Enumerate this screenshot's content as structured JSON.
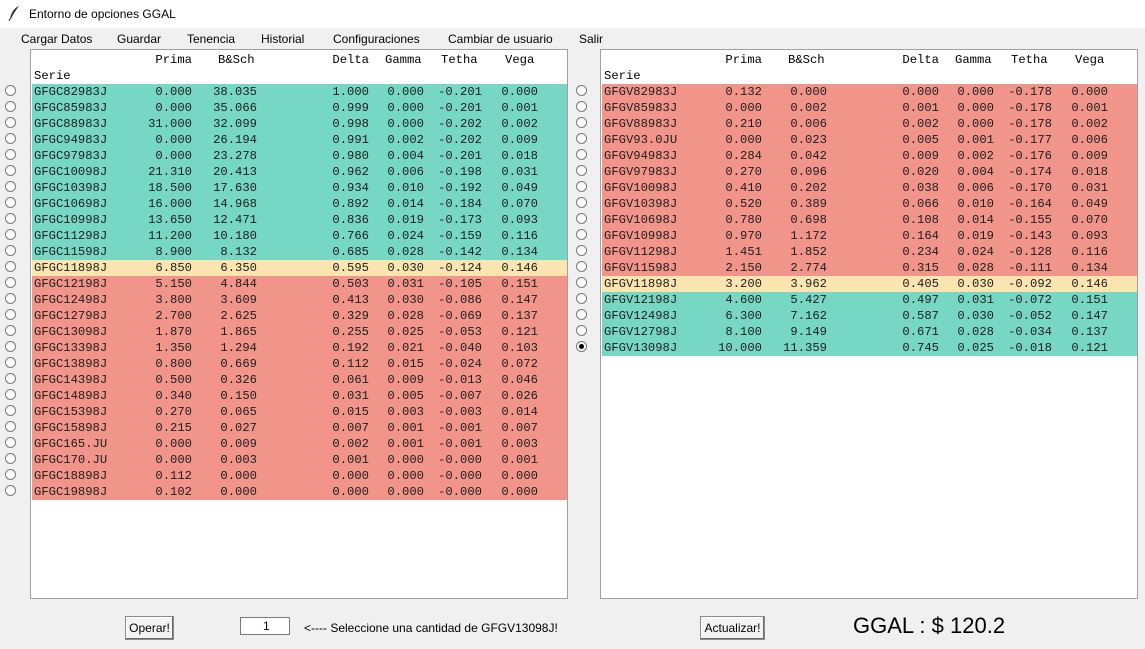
{
  "window": {
    "title": "Entorno de opciones GGAL",
    "icon": "feather-icon"
  },
  "menu": [
    "Cargar Datos",
    "Guardar",
    "Tenencia",
    "Historial",
    "Configuraciones",
    "Cambiar de usuario",
    "Salir"
  ],
  "columns": [
    "Serie",
    "Prima",
    "B&Sch",
    "Delta",
    "Gamma",
    "Tetha",
    "Vega"
  ],
  "colors": {
    "green": "#76d7c4",
    "red": "#f1948a",
    "yellow": "#fae5b0"
  },
  "calls": [
    {
      "serie": "GFGC82983J",
      "prima": "0.000",
      "bsch": "38.035",
      "delta": "1.000",
      "gamma": "0.000",
      "tetha": "-0.201",
      "vega": "0.000",
      "color": "green"
    },
    {
      "serie": "GFGC85983J",
      "prima": "0.000",
      "bsch": "35.066",
      "delta": "0.999",
      "gamma": "0.000",
      "tetha": "-0.201",
      "vega": "0.001",
      "color": "green"
    },
    {
      "serie": "GFGC88983J",
      "prima": "31.000",
      "bsch": "32.099",
      "delta": "0.998",
      "gamma": "0.000",
      "tetha": "-0.202",
      "vega": "0.002",
      "color": "green"
    },
    {
      "serie": "GFGC94983J",
      "prima": "0.000",
      "bsch": "26.194",
      "delta": "0.991",
      "gamma": "0.002",
      "tetha": "-0.202",
      "vega": "0.009",
      "color": "green"
    },
    {
      "serie": "GFGC97983J",
      "prima": "0.000",
      "bsch": "23.278",
      "delta": "0.980",
      "gamma": "0.004",
      "tetha": "-0.201",
      "vega": "0.018",
      "color": "green"
    },
    {
      "serie": "GFGC10098J",
      "prima": "21.310",
      "bsch": "20.413",
      "delta": "0.962",
      "gamma": "0.006",
      "tetha": "-0.198",
      "vega": "0.031",
      "color": "green"
    },
    {
      "serie": "GFGC10398J",
      "prima": "18.500",
      "bsch": "17.630",
      "delta": "0.934",
      "gamma": "0.010",
      "tetha": "-0.192",
      "vega": "0.049",
      "color": "green"
    },
    {
      "serie": "GFGC10698J",
      "prima": "16.000",
      "bsch": "14.968",
      "delta": "0.892",
      "gamma": "0.014",
      "tetha": "-0.184",
      "vega": "0.070",
      "color": "green"
    },
    {
      "serie": "GFGC10998J",
      "prima": "13.650",
      "bsch": "12.471",
      "delta": "0.836",
      "gamma": "0.019",
      "tetha": "-0.173",
      "vega": "0.093",
      "color": "green"
    },
    {
      "serie": "GFGC11298J",
      "prima": "11.200",
      "bsch": "10.180",
      "delta": "0.766",
      "gamma": "0.024",
      "tetha": "-0.159",
      "vega": "0.116",
      "color": "green"
    },
    {
      "serie": "GFGC11598J",
      "prima": "8.900",
      "bsch": "8.132",
      "delta": "0.685",
      "gamma": "0.028",
      "tetha": "-0.142",
      "vega": "0.134",
      "color": "green"
    },
    {
      "serie": "GFGC11898J",
      "prima": "6.850",
      "bsch": "6.350",
      "delta": "0.595",
      "gamma": "0.030",
      "tetha": "-0.124",
      "vega": "0.146",
      "color": "yellow"
    },
    {
      "serie": "GFGC12198J",
      "prima": "5.150",
      "bsch": "4.844",
      "delta": "0.503",
      "gamma": "0.031",
      "tetha": "-0.105",
      "vega": "0.151",
      "color": "red"
    },
    {
      "serie": "GFGC12498J",
      "prima": "3.800",
      "bsch": "3.609",
      "delta": "0.413",
      "gamma": "0.030",
      "tetha": "-0.086",
      "vega": "0.147",
      "color": "red"
    },
    {
      "serie": "GFGC12798J",
      "prima": "2.700",
      "bsch": "2.625",
      "delta": "0.329",
      "gamma": "0.028",
      "tetha": "-0.069",
      "vega": "0.137",
      "color": "red"
    },
    {
      "serie": "GFGC13098J",
      "prima": "1.870",
      "bsch": "1.865",
      "delta": "0.255",
      "gamma": "0.025",
      "tetha": "-0.053",
      "vega": "0.121",
      "color": "red"
    },
    {
      "serie": "GFGC13398J",
      "prima": "1.350",
      "bsch": "1.294",
      "delta": "0.192",
      "gamma": "0.021",
      "tetha": "-0.040",
      "vega": "0.103",
      "color": "red"
    },
    {
      "serie": "GFGC13898J",
      "prima": "0.800",
      "bsch": "0.669",
      "delta": "0.112",
      "gamma": "0.015",
      "tetha": "-0.024",
      "vega": "0.072",
      "color": "red"
    },
    {
      "serie": "GFGC14398J",
      "prima": "0.500",
      "bsch": "0.326",
      "delta": "0.061",
      "gamma": "0.009",
      "tetha": "-0.013",
      "vega": "0.046",
      "color": "red"
    },
    {
      "serie": "GFGC14898J",
      "prima": "0.340",
      "bsch": "0.150",
      "delta": "0.031",
      "gamma": "0.005",
      "tetha": "-0.007",
      "vega": "0.026",
      "color": "red"
    },
    {
      "serie": "GFGC15398J",
      "prima": "0.270",
      "bsch": "0.065",
      "delta": "0.015",
      "gamma": "0.003",
      "tetha": "-0.003",
      "vega": "0.014",
      "color": "red"
    },
    {
      "serie": "GFGC15898J",
      "prima": "0.215",
      "bsch": "0.027",
      "delta": "0.007",
      "gamma": "0.001",
      "tetha": "-0.001",
      "vega": "0.007",
      "color": "red"
    },
    {
      "serie": "GFGC165.JU",
      "prima": "0.000",
      "bsch": "0.009",
      "delta": "0.002",
      "gamma": "0.001",
      "tetha": "-0.001",
      "vega": "0.003",
      "color": "red"
    },
    {
      "serie": "GFGC170.JU",
      "prima": "0.000",
      "bsch": "0.003",
      "delta": "0.001",
      "gamma": "0.000",
      "tetha": "-0.000",
      "vega": "0.001",
      "color": "red"
    },
    {
      "serie": "GFGC18898J",
      "prima": "0.112",
      "bsch": "0.000",
      "delta": "0.000",
      "gamma": "0.000",
      "tetha": "-0.000",
      "vega": "0.000",
      "color": "red"
    },
    {
      "serie": "GFGC19898J",
      "prima": "0.102",
      "bsch": "0.000",
      "delta": "0.000",
      "gamma": "0.000",
      "tetha": "-0.000",
      "vega": "0.000",
      "color": "red"
    }
  ],
  "puts": [
    {
      "serie": "GFGV82983J",
      "prima": "0.132",
      "bsch": "0.000",
      "delta": "0.000",
      "gamma": "0.000",
      "tetha": "-0.178",
      "vega": "0.000",
      "color": "red"
    },
    {
      "serie": "GFGV85983J",
      "prima": "0.000",
      "bsch": "0.002",
      "delta": "0.001",
      "gamma": "0.000",
      "tetha": "-0.178",
      "vega": "0.001",
      "color": "red"
    },
    {
      "serie": "GFGV88983J",
      "prima": "0.210",
      "bsch": "0.006",
      "delta": "0.002",
      "gamma": "0.000",
      "tetha": "-0.178",
      "vega": "0.002",
      "color": "red"
    },
    {
      "serie": "GFGV93.0JU",
      "prima": "0.000",
      "bsch": "0.023",
      "delta": "0.005",
      "gamma": "0.001",
      "tetha": "-0.177",
      "vega": "0.006",
      "color": "red"
    },
    {
      "serie": "GFGV94983J",
      "prima": "0.284",
      "bsch": "0.042",
      "delta": "0.009",
      "gamma": "0.002",
      "tetha": "-0.176",
      "vega": "0.009",
      "color": "red"
    },
    {
      "serie": "GFGV97983J",
      "prima": "0.270",
      "bsch": "0.096",
      "delta": "0.020",
      "gamma": "0.004",
      "tetha": "-0.174",
      "vega": "0.018",
      "color": "red"
    },
    {
      "serie": "GFGV10098J",
      "prima": "0.410",
      "bsch": "0.202",
      "delta": "0.038",
      "gamma": "0.006",
      "tetha": "-0.170",
      "vega": "0.031",
      "color": "red"
    },
    {
      "serie": "GFGV10398J",
      "prima": "0.520",
      "bsch": "0.389",
      "delta": "0.066",
      "gamma": "0.010",
      "tetha": "-0.164",
      "vega": "0.049",
      "color": "red"
    },
    {
      "serie": "GFGV10698J",
      "prima": "0.780",
      "bsch": "0.698",
      "delta": "0.108",
      "gamma": "0.014",
      "tetha": "-0.155",
      "vega": "0.070",
      "color": "red"
    },
    {
      "serie": "GFGV10998J",
      "prima": "0.970",
      "bsch": "1.172",
      "delta": "0.164",
      "gamma": "0.019",
      "tetha": "-0.143",
      "vega": "0.093",
      "color": "red"
    },
    {
      "serie": "GFGV11298J",
      "prima": "1.451",
      "bsch": "1.852",
      "delta": "0.234",
      "gamma": "0.024",
      "tetha": "-0.128",
      "vega": "0.116",
      "color": "red"
    },
    {
      "serie": "GFGV11598J",
      "prima": "2.150",
      "bsch": "2.774",
      "delta": "0.315",
      "gamma": "0.028",
      "tetha": "-0.111",
      "vega": "0.134",
      "color": "red"
    },
    {
      "serie": "GFGV11898J",
      "prima": "3.200",
      "bsch": "3.962",
      "delta": "0.405",
      "gamma": "0.030",
      "tetha": "-0.092",
      "vega": "0.146",
      "color": "yellow"
    },
    {
      "serie": "GFGV12198J",
      "prima": "4.600",
      "bsch": "5.427",
      "delta": "0.497",
      "gamma": "0.031",
      "tetha": "-0.072",
      "vega": "0.151",
      "color": "green"
    },
    {
      "serie": "GFGV12498J",
      "prima": "6.300",
      "bsch": "7.162",
      "delta": "0.587",
      "gamma": "0.030",
      "tetha": "-0.052",
      "vega": "0.147",
      "color": "green"
    },
    {
      "serie": "GFGV12798J",
      "prima": "8.100",
      "bsch": "9.149",
      "delta": "0.671",
      "gamma": "0.028",
      "tetha": "-0.034",
      "vega": "0.137",
      "color": "green"
    },
    {
      "serie": "GFGV13098J",
      "prima": "10.000",
      "bsch": "11.359",
      "delta": "0.745",
      "gamma": "0.025",
      "tetha": "-0.018",
      "vega": "0.121",
      "color": "green"
    }
  ],
  "selected_put_index": 16,
  "bottom": {
    "operar_label": "Operar!",
    "quantity_value": "1",
    "hint_text": "<----   Seleccione una cantidad de GFGV13098J!",
    "actualizar_label": "Actualizar!",
    "price_text": "GGAL : $ 120.2"
  }
}
